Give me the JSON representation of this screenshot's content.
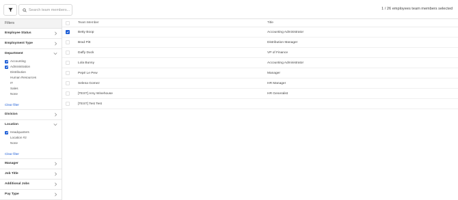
{
  "toolbar": {
    "filter_icon": "funnel-icon",
    "search_placeholder": "Search team members...",
    "search_value": "",
    "count_text": "1 / 26 employees team members selected"
  },
  "sidebar": {
    "header": "Filters",
    "sections": [
      {
        "label": "Employee Status"
      },
      {
        "label": "Employment Type"
      },
      {
        "label": "Department",
        "options": [
          {
            "label": "Accounting",
            "checked": true
          },
          {
            "label": "Administration",
            "checked": true
          },
          {
            "label": "Distribution",
            "checked": false
          },
          {
            "label": "Human Resources",
            "checked": false
          },
          {
            "label": "IT",
            "checked": false
          },
          {
            "label": "Sales",
            "checked": false
          },
          {
            "label": "None",
            "checked": false
          }
        ],
        "clear_label": "Clear filter"
      },
      {
        "label": "Division"
      },
      {
        "label": "Location",
        "options": [
          {
            "label": "Headquarters",
            "checked": true
          },
          {
            "label": "Location #2",
            "checked": false
          },
          {
            "label": "None",
            "checked": false
          }
        ],
        "clear_label": "Clear filter"
      },
      {
        "label": "Manager"
      },
      {
        "label": "Job Title"
      },
      {
        "label": "Additional Jobs"
      },
      {
        "label": "Pay Type"
      }
    ]
  },
  "table": {
    "columns": [
      "Team Member",
      "Title"
    ],
    "rows": [
      {
        "name": "Betty Boop",
        "title": "Accounting Administrator",
        "selected": true
      },
      {
        "name": "Brad Pitt",
        "title": "Distribution Manager",
        "selected": false
      },
      {
        "name": "Daffy Duck",
        "title": "VP of Finance",
        "selected": false
      },
      {
        "name": "Lola Bunny",
        "title": "Accounting Administrator",
        "selected": false
      },
      {
        "name": "Pepé Le Pew",
        "title": "Manager",
        "selected": false
      },
      {
        "name": "Selena Gomez",
        "title": "HR Manager",
        "selected": false
      },
      {
        "name": "[TEST] Amy Winehouse",
        "title": "HR Generalist",
        "selected": false
      },
      {
        "name": "[TEST] Test Test",
        "title": "",
        "selected": false
      }
    ]
  },
  "colors": {
    "accent": "#1f5fd6",
    "border": "#e3e3e3"
  }
}
